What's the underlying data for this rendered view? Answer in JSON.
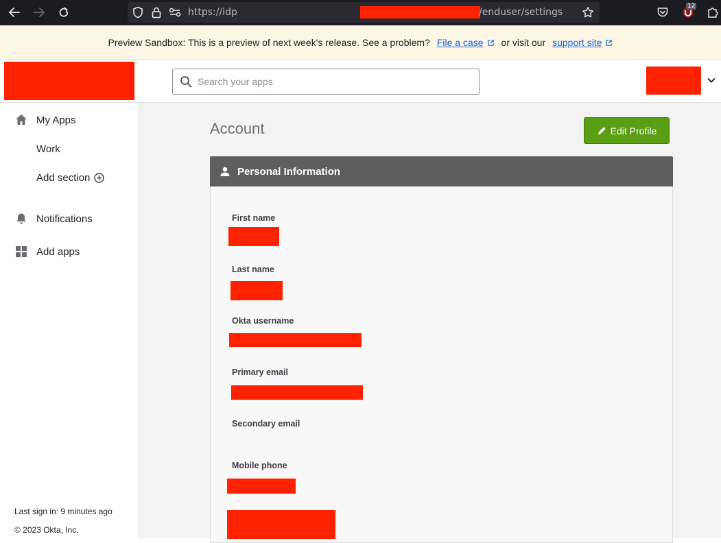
{
  "browser": {
    "url_prefix": "https://idp",
    "url_suffix": "/enduser/settings",
    "extension_badge": "12"
  },
  "banner": {
    "message": "Preview Sandbox: This is a preview of next week's release. See a problem?",
    "file_case_link": "File a case",
    "middle_text": "or visit our",
    "support_link": "support site"
  },
  "header": {
    "search_placeholder": "Search your apps"
  },
  "sidebar": {
    "my_apps": "My Apps",
    "work": "Work",
    "add_section": "Add section",
    "notifications": "Notifications",
    "add_apps": "Add apps",
    "last_sign_in": "Last sign in: 9 minutes ago",
    "copyright": "© 2023 Okta, Inc."
  },
  "main": {
    "title": "Account",
    "edit_profile": "Edit Profile",
    "panel_title": "Personal Information",
    "fields": {
      "first_name": "First name",
      "last_name": "Last name",
      "okta_username": "Okta username",
      "primary_email": "Primary email",
      "secondary_email": "Secondary email",
      "mobile_phone": "Mobile phone"
    }
  },
  "colors": {
    "banner_bg": "#fcf7e4",
    "link": "#1662dd",
    "edit_button": "#5a9e14",
    "panel_header": "#5e5e5e",
    "redaction": "#ff2200"
  }
}
